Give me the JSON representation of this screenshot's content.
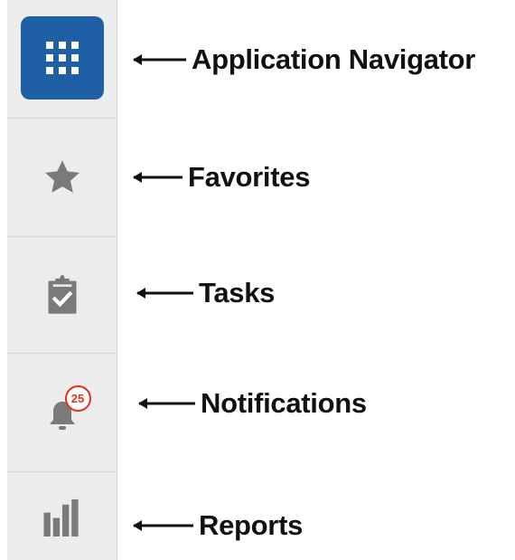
{
  "colors": {
    "rail_background": "#ececec",
    "app_navigator_tile": "#1f5fa6",
    "icon_gray": "#7a7a7a",
    "badge_red": "#e0301e"
  },
  "rail": {
    "items": [
      {
        "id": "app-navigator",
        "icon": "grid-icon"
      },
      {
        "id": "favorites",
        "icon": "star-icon"
      },
      {
        "id": "tasks",
        "icon": "clipboard-check-icon"
      },
      {
        "id": "notifications",
        "icon": "bell-icon",
        "badge_count": "25"
      },
      {
        "id": "reports",
        "icon": "bar-chart-icon"
      }
    ]
  },
  "callouts": {
    "app_navigator": "Application Navigator",
    "favorites": "Favorites",
    "tasks": "Tasks",
    "notifications": "Notifications",
    "reports": "Reports"
  }
}
